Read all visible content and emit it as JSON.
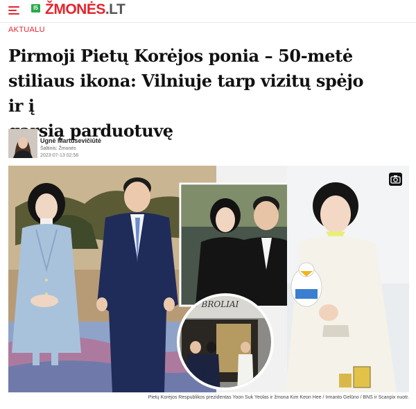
{
  "topbar": {
    "menu_icon": "hamburger-menu-icon",
    "age_rating": "I5",
    "logo_brand": "ŽMONĖS",
    "logo_tld": ".LT",
    "accent_color": "#e4242c"
  },
  "article": {
    "section": "AKTUALU",
    "headline_lines": [
      "Pirmoji Pietų Korėjos ponia – 50-metė",
      "stiliaus ikona: Vilniuje tarp vizitų spėjo ir į",
      "garsią parduotuvę"
    ],
    "author": {
      "name": "Ugnė Martusevičiūtė",
      "source": "Šaltinis: Žmonės",
      "date": "2023-07-13 02:56"
    },
    "image": {
      "storefront_sign": "DU BROLIAI",
      "gallery_icon": "camera-icon",
      "caption": "Pietų Korėjos Respublikos prezidentas Yoon Suk Yeolas ir žmona Kim Keon Hee / Irmanto Gelūno / BNS ir Scanpix nuotr."
    }
  }
}
